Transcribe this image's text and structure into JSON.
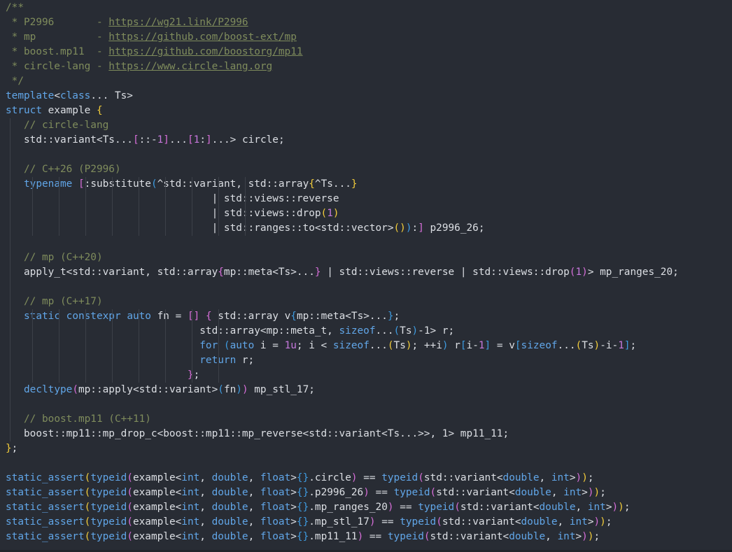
{
  "colors": {
    "background": "#282c34",
    "comment": "#7f8c5c",
    "keyword": "#61a6e8",
    "bracket_gold": "#f2cc3a",
    "bracket_purple": "#d66ed8",
    "bracket_blue": "#3e9be0",
    "number": "#c679dd",
    "text": "#dcdfe4"
  },
  "code": {
    "lines": [
      [
        [
          "c",
          "/**"
        ]
      ],
      [
        [
          "c",
          " * P2996       - "
        ],
        [
          "u",
          "https://wg21.link/P2996"
        ]
      ],
      [
        [
          "c",
          " * mp          - "
        ],
        [
          "u",
          "https://github.com/boost-ext/mp"
        ]
      ],
      [
        [
          "c",
          " * boost.mp11  - "
        ],
        [
          "u",
          "https://github.com/boostorg/mp11"
        ]
      ],
      [
        [
          "c",
          " * circle-lang - "
        ],
        [
          "u",
          "https://www.circle-lang.org"
        ]
      ],
      [
        [
          "c",
          " */"
        ]
      ],
      [
        [
          "k",
          "template"
        ],
        [
          "t",
          "<"
        ],
        [
          "k",
          "class"
        ],
        [
          "t",
          "... Ts>"
        ]
      ],
      [
        [
          "k",
          "struct"
        ],
        [
          "t",
          " example "
        ],
        [
          "p1",
          "{"
        ]
      ],
      [
        [
          "t",
          "   "
        ],
        [
          "c",
          "// circle-lang"
        ]
      ],
      [
        [
          "t",
          "   std::variant<Ts..."
        ],
        [
          "p2",
          "["
        ],
        [
          "t",
          "::-"
        ],
        [
          "n",
          "1"
        ],
        [
          "p2",
          "]"
        ],
        [
          "t",
          "..."
        ],
        [
          "p2",
          "["
        ],
        [
          "n",
          "1"
        ],
        [
          "t",
          ":"
        ],
        [
          "p2",
          "]"
        ],
        [
          "t",
          "...> circle;"
        ]
      ],
      [
        [
          "t",
          ""
        ]
      ],
      [
        [
          "t",
          "   "
        ],
        [
          "c",
          "// C++26 (P2996)"
        ]
      ],
      [
        [
          "t",
          "   "
        ],
        [
          "k",
          "typename"
        ],
        [
          "t",
          " "
        ],
        [
          "p2",
          "["
        ],
        [
          "t",
          ":substitute"
        ],
        [
          "p3",
          "("
        ],
        [
          "t",
          "^std::variant, std::array"
        ],
        [
          "p1",
          "{"
        ],
        [
          "t",
          "^Ts..."
        ],
        [
          "p1",
          "}"
        ]
      ],
      [
        [
          "t",
          "                                  | std::views::reverse"
        ]
      ],
      [
        [
          "t",
          "                                  | std::views::drop"
        ],
        [
          "p1",
          "("
        ],
        [
          "n",
          "1"
        ],
        [
          "p1",
          ")"
        ]
      ],
      [
        [
          "t",
          "                                  | std::ranges::to<std::vector>"
        ],
        [
          "p1",
          "("
        ],
        [
          "p1",
          ")"
        ],
        [
          "p3",
          ")"
        ],
        [
          "t",
          ":"
        ],
        [
          "p2",
          "]"
        ],
        [
          "t",
          " p2996_26;"
        ]
      ],
      [
        [
          "t",
          ""
        ]
      ],
      [
        [
          "t",
          "   "
        ],
        [
          "c",
          "// mp (C++20)"
        ]
      ],
      [
        [
          "t",
          "   apply_t<std::variant, std::array"
        ],
        [
          "p2",
          "{"
        ],
        [
          "t",
          "mp::meta<Ts>..."
        ],
        [
          "p2",
          "}"
        ],
        [
          "t",
          " | std::views::reverse | std::views::drop"
        ],
        [
          "p2",
          "("
        ],
        [
          "n",
          "1"
        ],
        [
          "p2",
          ")"
        ],
        [
          "t",
          "> mp_ranges_20;"
        ]
      ],
      [
        [
          "t",
          ""
        ]
      ],
      [
        [
          "t",
          "   "
        ],
        [
          "c",
          "// mp (C++17)"
        ]
      ],
      [
        [
          "t",
          "   "
        ],
        [
          "k",
          "static"
        ],
        [
          "t",
          " "
        ],
        [
          "k",
          "constexpr"
        ],
        [
          "t",
          " "
        ],
        [
          "k",
          "auto"
        ],
        [
          "t",
          " fn = "
        ],
        [
          "p2",
          "[]"
        ],
        [
          "t",
          " "
        ],
        [
          "p2",
          "{"
        ],
        [
          "t",
          " std::array v"
        ],
        [
          "p3",
          "{"
        ],
        [
          "t",
          "mp::meta<Ts>..."
        ],
        [
          "p3",
          "}"
        ],
        [
          "t",
          ";"
        ]
      ],
      [
        [
          "t",
          "                                std::array<mp::meta_t, "
        ],
        [
          "k",
          "sizeof"
        ],
        [
          "t",
          "..."
        ],
        [
          "p3",
          "("
        ],
        [
          "t",
          "Ts"
        ],
        [
          "p3",
          ")"
        ],
        [
          "t",
          "-1> r;"
        ]
      ],
      [
        [
          "t",
          "                                "
        ],
        [
          "k",
          "for"
        ],
        [
          "t",
          " "
        ],
        [
          "p3",
          "("
        ],
        [
          "k",
          "auto"
        ],
        [
          "t",
          " i = "
        ],
        [
          "n",
          "1u"
        ],
        [
          "t",
          "; i < "
        ],
        [
          "k",
          "sizeof"
        ],
        [
          "t",
          "..."
        ],
        [
          "p1",
          "("
        ],
        [
          "t",
          "Ts"
        ],
        [
          "p1",
          ")"
        ],
        [
          "t",
          "; ++i"
        ],
        [
          "p3",
          ")"
        ],
        [
          "t",
          " r"
        ],
        [
          "p3",
          "["
        ],
        [
          "t",
          "i-"
        ],
        [
          "n",
          "1"
        ],
        [
          "p3",
          "]"
        ],
        [
          "t",
          " = v"
        ],
        [
          "p3",
          "["
        ],
        [
          "k",
          "sizeof"
        ],
        [
          "t",
          "..."
        ],
        [
          "p1",
          "("
        ],
        [
          "t",
          "Ts"
        ],
        [
          "p1",
          ")"
        ],
        [
          "t",
          "-i-"
        ],
        [
          "n",
          "1"
        ],
        [
          "p3",
          "]"
        ],
        [
          "t",
          ";"
        ]
      ],
      [
        [
          "t",
          "                                "
        ],
        [
          "k",
          "return"
        ],
        [
          "t",
          " r;"
        ]
      ],
      [
        [
          "t",
          "                              "
        ],
        [
          "p2",
          "}"
        ],
        [
          "t",
          ";"
        ]
      ],
      [
        [
          "t",
          "   "
        ],
        [
          "k",
          "decltype"
        ],
        [
          "p2",
          "("
        ],
        [
          "t",
          "mp::apply<std::variant>"
        ],
        [
          "p3",
          "("
        ],
        [
          "t",
          "fn"
        ],
        [
          "p3",
          ")"
        ],
        [
          "p2",
          ")"
        ],
        [
          "t",
          " mp_stl_17;"
        ]
      ],
      [
        [
          "t",
          ""
        ]
      ],
      [
        [
          "t",
          "   "
        ],
        [
          "c",
          "// boost.mp11 (C++11)"
        ]
      ],
      [
        [
          "t",
          "   boost::mp11::mp_drop_c<boost::mp11::mp_reverse<std::variant<Ts...>>, 1> mp11_11;"
        ]
      ],
      [
        [
          "p1",
          "}"
        ],
        [
          "t",
          ";"
        ]
      ],
      [
        [
          "t",
          ""
        ]
      ],
      [
        [
          "k",
          "static_assert"
        ],
        [
          "p1",
          "("
        ],
        [
          "k",
          "typeid"
        ],
        [
          "p2",
          "("
        ],
        [
          "t",
          "example<"
        ],
        [
          "k",
          "int"
        ],
        [
          "t",
          ", "
        ],
        [
          "k",
          "double"
        ],
        [
          "t",
          ", "
        ],
        [
          "k",
          "float"
        ],
        [
          "t",
          ">"
        ],
        [
          "p3",
          "{}"
        ],
        [
          "t",
          ".circle"
        ],
        [
          "p2",
          ")"
        ],
        [
          "t",
          " == "
        ],
        [
          "k",
          "typeid"
        ],
        [
          "p2",
          "("
        ],
        [
          "t",
          "std::variant<"
        ],
        [
          "k",
          "double"
        ],
        [
          "t",
          ", "
        ],
        [
          "k",
          "int"
        ],
        [
          "t",
          ">"
        ],
        [
          "p2",
          ")"
        ],
        [
          "p1",
          ")"
        ],
        [
          "t",
          ";"
        ]
      ],
      [
        [
          "k",
          "static_assert"
        ],
        [
          "p1",
          "("
        ],
        [
          "k",
          "typeid"
        ],
        [
          "p2",
          "("
        ],
        [
          "t",
          "example<"
        ],
        [
          "k",
          "int"
        ],
        [
          "t",
          ", "
        ],
        [
          "k",
          "double"
        ],
        [
          "t",
          ", "
        ],
        [
          "k",
          "float"
        ],
        [
          "t",
          ">"
        ],
        [
          "p3",
          "{}"
        ],
        [
          "t",
          ".p2996_26"
        ],
        [
          "p2",
          ")"
        ],
        [
          "t",
          " == "
        ],
        [
          "k",
          "typeid"
        ],
        [
          "p2",
          "("
        ],
        [
          "t",
          "std::variant<"
        ],
        [
          "k",
          "double"
        ],
        [
          "t",
          ", "
        ],
        [
          "k",
          "int"
        ],
        [
          "t",
          ">"
        ],
        [
          "p2",
          ")"
        ],
        [
          "p1",
          ")"
        ],
        [
          "t",
          ";"
        ]
      ],
      [
        [
          "k",
          "static_assert"
        ],
        [
          "p1",
          "("
        ],
        [
          "k",
          "typeid"
        ],
        [
          "p2",
          "("
        ],
        [
          "t",
          "example<"
        ],
        [
          "k",
          "int"
        ],
        [
          "t",
          ", "
        ],
        [
          "k",
          "double"
        ],
        [
          "t",
          ", "
        ],
        [
          "k",
          "float"
        ],
        [
          "t",
          ">"
        ],
        [
          "p3",
          "{}"
        ],
        [
          "t",
          ".mp_ranges_20"
        ],
        [
          "p2",
          ")"
        ],
        [
          "t",
          " == "
        ],
        [
          "k",
          "typeid"
        ],
        [
          "p2",
          "("
        ],
        [
          "t",
          "std::variant<"
        ],
        [
          "k",
          "double"
        ],
        [
          "t",
          ", "
        ],
        [
          "k",
          "int"
        ],
        [
          "t",
          ">"
        ],
        [
          "p2",
          ")"
        ],
        [
          "p1",
          ")"
        ],
        [
          "t",
          ";"
        ]
      ],
      [
        [
          "k",
          "static_assert"
        ],
        [
          "p1",
          "("
        ],
        [
          "k",
          "typeid"
        ],
        [
          "p2",
          "("
        ],
        [
          "t",
          "example<"
        ],
        [
          "k",
          "int"
        ],
        [
          "t",
          ", "
        ],
        [
          "k",
          "double"
        ],
        [
          "t",
          ", "
        ],
        [
          "k",
          "float"
        ],
        [
          "t",
          ">"
        ],
        [
          "p3",
          "{}"
        ],
        [
          "t",
          ".mp_stl_17"
        ],
        [
          "p2",
          ")"
        ],
        [
          "t",
          " == "
        ],
        [
          "k",
          "typeid"
        ],
        [
          "p2",
          "("
        ],
        [
          "t",
          "std::variant<"
        ],
        [
          "k",
          "double"
        ],
        [
          "t",
          ", "
        ],
        [
          "k",
          "int"
        ],
        [
          "t",
          ">"
        ],
        [
          "p2",
          ")"
        ],
        [
          "p1",
          ")"
        ],
        [
          "t",
          ";"
        ]
      ],
      [
        [
          "k",
          "static_assert"
        ],
        [
          "p1",
          "("
        ],
        [
          "k",
          "typeid"
        ],
        [
          "p2",
          "("
        ],
        [
          "t",
          "example<"
        ],
        [
          "k",
          "int"
        ],
        [
          "t",
          ", "
        ],
        [
          "k",
          "double"
        ],
        [
          "t",
          ", "
        ],
        [
          "k",
          "float"
        ],
        [
          "t",
          ">"
        ],
        [
          "p3",
          "{}"
        ],
        [
          "t",
          ".mp11_11"
        ],
        [
          "p2",
          ")"
        ],
        [
          "t",
          " == "
        ],
        [
          "k",
          "typeid"
        ],
        [
          "p2",
          "("
        ],
        [
          "t",
          "std::variant<"
        ],
        [
          "k",
          "double"
        ],
        [
          "t",
          ", "
        ],
        [
          "k",
          "int"
        ],
        [
          "t",
          ">"
        ],
        [
          "p2",
          ")"
        ],
        [
          "p1",
          ")"
        ],
        [
          "t",
          ";"
        ]
      ]
    ]
  }
}
